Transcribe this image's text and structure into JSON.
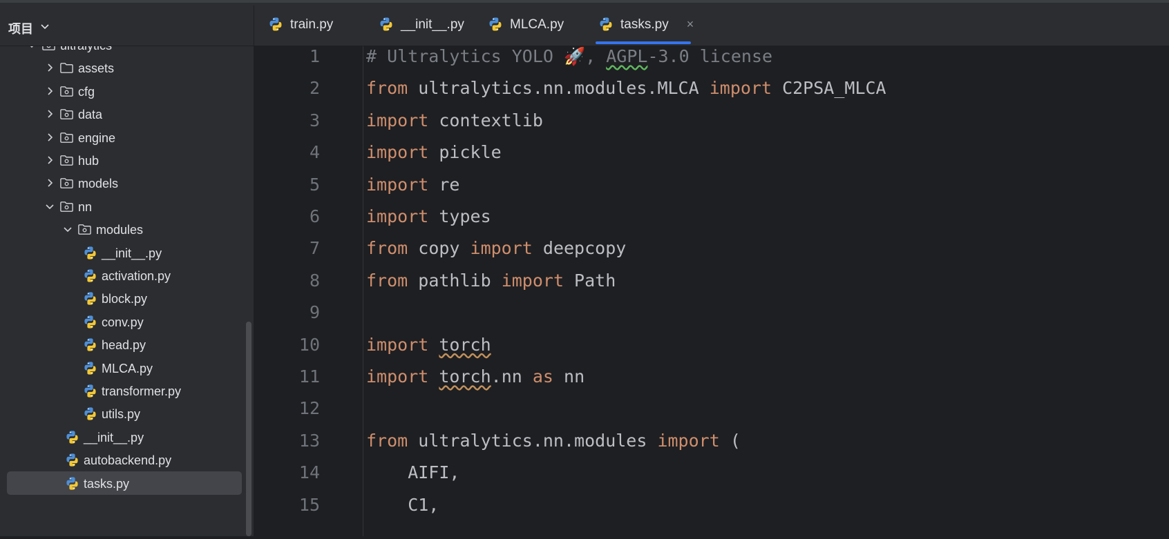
{
  "sidebar": {
    "title": "项目",
    "tree": [
      {
        "label": "ultralytics",
        "type": "package",
        "indent": 0,
        "chevron": "down"
      },
      {
        "label": "assets",
        "type": "folder",
        "indent": 1,
        "chevron": "right"
      },
      {
        "label": "cfg",
        "type": "package",
        "indent": 1,
        "chevron": "right"
      },
      {
        "label": "data",
        "type": "package",
        "indent": 1,
        "chevron": "right"
      },
      {
        "label": "engine",
        "type": "package",
        "indent": 1,
        "chevron": "right"
      },
      {
        "label": "hub",
        "type": "package",
        "indent": 1,
        "chevron": "right"
      },
      {
        "label": "models",
        "type": "package",
        "indent": 1,
        "chevron": "right"
      },
      {
        "label": "nn",
        "type": "package",
        "indent": 1,
        "chevron": "down"
      },
      {
        "label": "modules",
        "type": "package",
        "indent": 2,
        "chevron": "down"
      },
      {
        "label": "__init__.py",
        "type": "python",
        "indent": 3
      },
      {
        "label": "activation.py",
        "type": "python",
        "indent": 3
      },
      {
        "label": "block.py",
        "type": "python",
        "indent": 3
      },
      {
        "label": "conv.py",
        "type": "python",
        "indent": 3
      },
      {
        "label": "head.py",
        "type": "python",
        "indent": 3
      },
      {
        "label": "MLCA.py",
        "type": "python",
        "indent": 3
      },
      {
        "label": "transformer.py",
        "type": "python",
        "indent": 3
      },
      {
        "label": "utils.py",
        "type": "python",
        "indent": 3
      },
      {
        "label": "__init__.py",
        "type": "python",
        "indent": 2
      },
      {
        "label": "autobackend.py",
        "type": "python",
        "indent": 2
      },
      {
        "label": "tasks.py",
        "type": "python",
        "indent": 2,
        "selected": true
      }
    ]
  },
  "tabs": [
    {
      "label": "train.py",
      "active": false
    },
    {
      "label": "__init__.py",
      "active": false
    },
    {
      "label": "MLCA.py",
      "active": false
    },
    {
      "label": "tasks.py",
      "active": true,
      "close": "×"
    }
  ],
  "editor": {
    "lines": [
      {
        "n": "1",
        "tokens": [
          {
            "t": "# Ultralytics YOLO 🚀, ",
            "c": "cm"
          },
          {
            "t": "AGPL",
            "c": "cm warn-green"
          },
          {
            "t": "-3.0 license",
            "c": "cm"
          }
        ]
      },
      {
        "n": "2",
        "tokens": [
          {
            "t": "from",
            "c": "kw"
          },
          {
            "t": " ultralytics.nn.modules.MLCA "
          },
          {
            "t": "import",
            "c": "kw"
          },
          {
            "t": " C2PSA_MLCA"
          }
        ]
      },
      {
        "n": "3",
        "tokens": [
          {
            "t": "import",
            "c": "kw"
          },
          {
            "t": " contextlib"
          }
        ]
      },
      {
        "n": "4",
        "tokens": [
          {
            "t": "import",
            "c": "kw"
          },
          {
            "t": " pickle"
          }
        ]
      },
      {
        "n": "5",
        "tokens": [
          {
            "t": "import",
            "c": "kw"
          },
          {
            "t": " re"
          }
        ]
      },
      {
        "n": "6",
        "tokens": [
          {
            "t": "import",
            "c": "kw"
          },
          {
            "t": " types"
          }
        ]
      },
      {
        "n": "7",
        "tokens": [
          {
            "t": "from",
            "c": "kw"
          },
          {
            "t": " copy "
          },
          {
            "t": "import",
            "c": "kw"
          },
          {
            "t": " deepcopy"
          }
        ]
      },
      {
        "n": "8",
        "tokens": [
          {
            "t": "from",
            "c": "kw"
          },
          {
            "t": " pathlib "
          },
          {
            "t": "import",
            "c": "kw"
          },
          {
            "t": " Path"
          }
        ]
      },
      {
        "n": "9",
        "tokens": []
      },
      {
        "n": "10",
        "tokens": [
          {
            "t": "import",
            "c": "kw"
          },
          {
            "t": " "
          },
          {
            "t": "torch",
            "c": "warn-orange"
          }
        ]
      },
      {
        "n": "11",
        "tokens": [
          {
            "t": "import",
            "c": "kw"
          },
          {
            "t": " "
          },
          {
            "t": "torch",
            "c": "warn-orange"
          },
          {
            "t": ".nn "
          },
          {
            "t": "as",
            "c": "kw"
          },
          {
            "t": " nn"
          }
        ]
      },
      {
        "n": "12",
        "tokens": []
      },
      {
        "n": "13",
        "tokens": [
          {
            "t": "from",
            "c": "kw"
          },
          {
            "t": " ultralytics.nn.modules "
          },
          {
            "t": "import",
            "c": "kw"
          },
          {
            "t": " ("
          }
        ]
      },
      {
        "n": "14",
        "tokens": [
          {
            "t": "    AIFI,"
          }
        ]
      },
      {
        "n": "15",
        "tokens": [
          {
            "t": "    C1,"
          }
        ]
      }
    ]
  },
  "colors": {
    "keyword": "#cf8e6d",
    "comment": "#7a7e85",
    "text": "#bcbec4",
    "accent": "#3574f0",
    "selection": "#43454a"
  },
  "icons": {
    "folder": "folder-icon",
    "package": "package-icon",
    "python": "python-file-icon",
    "chevron_right": "chevron-right-icon",
    "chevron_down": "chevron-down-icon"
  }
}
